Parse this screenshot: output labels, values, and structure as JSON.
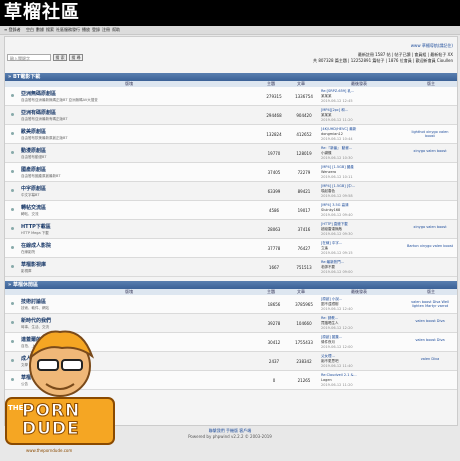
{
  "header": {
    "logo": "草榴社區"
  },
  "topnav": {
    "items": [
      "≡ 登錄者",
      "空白",
      "數據",
      "搜索",
      "社區服務",
      "發行",
      "播放",
      "登錄",
      "注冊",
      "幫助"
    ]
  },
  "userbar": {
    "text": "www 草榴導航(請記住)"
  },
  "stats": {
    "line1": "最新註冊 1587 帖 | 帖子已讀 | 會員組 | 最新帖子 XX",
    "line2": "共 807328 篇主題 | 12252891 篇帖子 | 1876 位會員 | 歡迎新會員 Cioullen"
  },
  "search": {
    "placeholder": "輸入關鍵字",
    "button1": "搜 索",
    "button2": "搜 尋"
  },
  "sections": [
    {
      "title": "» BT電影下載",
      "columns": [
        "版塊",
        "主題",
        "文章",
        "最後發表",
        "版主"
      ],
      "rows": [
        {
          "name": "亞洲無碼原創區",
          "desc": "自由發布亞洲最新無碼正版BT 亞洲無碼AV大搜查",
          "topics": "279315",
          "posts": "1336754",
          "last_title": "Re:[SRPZ-659] 乳...",
          "last_user": "某某某",
          "last_time": "2019-06-12 12:45",
          "mod": ""
        },
        {
          "name": "亞洲有碼原創區",
          "desc": "自由發布亞洲最新有碼正版BT",
          "topics": "294468",
          "posts": "904420",
          "last_title": "[MP4][2pc] 和...",
          "last_user": "某某某",
          "last_time": "2019-06-12 11:20",
          "mod": ""
        },
        {
          "name": "歐美原創區",
          "desc": "自由發布歐美最新原創正版BT",
          "topics": "132824",
          "posts": "412652",
          "last_title": "[4K/UHD/HEVC] 最新",
          "last_user": "dongmian12",
          "last_time": "2019-06-12 10:44",
          "mod": "lighthot xinygo valen boost"
        },
        {
          "name": "動漫原創區",
          "desc": "自由發布動漫BT",
          "topics": "19770",
          "posts": "128019",
          "last_title": "Re:『新番』 動畫...",
          "last_user": "小蝴蝶",
          "last_time": "2019-06-12 10:30",
          "mod": "xinygo valen boost"
        },
        {
          "name": "國產原創區",
          "desc": "自由發布國產原創最新BT",
          "topics": "37405",
          "posts": "72279",
          "last_title": "[MP4] [1.5GB] 國產",
          "last_user": "Wenzero",
          "last_time": "2019-06-12 10:11",
          "mod": ""
        },
        {
          "name": "中字原創區",
          "desc": "中文字幕BT",
          "topics": "63399",
          "posts": "89421",
          "last_title": "[MP4] [1.5GB] [中...",
          "last_user": "喚起春色",
          "last_time": "2019-06-12 09:58",
          "mod": ""
        },
        {
          "name": "轉帖交流區",
          "desc": "轉帖、交流",
          "topics": "4586",
          "posts": "19017",
          "last_title": "[MP4] 3.5G 高清",
          "last_user": "Sluinky168",
          "last_time": "2019-06-12 09:40",
          "mod": ""
        },
        {
          "name": "HTTP下載區",
          "desc": "HTTP Mega 下載",
          "topics": "28063",
          "posts": "37416",
          "last_title": "[HTTP] 直鏈下載",
          "last_user": "超級雷達無敵",
          "last_time": "2019-06-12 09:30",
          "mod": "xinygo valen boost"
        },
        {
          "name": "在線成人影院",
          "desc": "在線影院",
          "topics": "37778",
          "posts": "76427",
          "last_title": "[在線] 中字...",
          "last_user": "立遙",
          "last_time": "2019-06-12 09:15",
          "mod": "Barton xinygo valen boost"
        },
        {
          "name": "草榴影視庫",
          "desc": "影視庫",
          "topics": "1667",
          "posts": "751513",
          "last_title": "Re:最新熱門...",
          "last_user": "老師不要",
          "last_time": "2019-06-12 09:00",
          "mod": ""
        }
      ]
    },
    {
      "title": "» 草榴休閒區",
      "columns": [
        "版塊",
        "主題",
        "文章",
        "最後發表",
        "版主"
      ],
      "rows": [
        {
          "name": "技術討論區",
          "desc": "技術、軟件、網站",
          "topics": "18656",
          "posts": "3785965",
          "last_title": "[原創] 小說...",
          "last_user": "圍不遠鐵樹",
          "last_time": "2019-06-12 12:40",
          "mod": "valen boost Diva Well lighten Martyr varrot"
        },
        {
          "name": "新時代的我們",
          "desc": "時事、生活、交流",
          "topics": "39278",
          "posts": "104660",
          "last_title": "Re: 請教...",
          "last_user": "買腦喝生人",
          "last_time": "2019-06-12 12:20",
          "mod": "valen boost Diva"
        },
        {
          "name": "達蓋爾的旗幟",
          "desc": "自拍、上傳",
          "topics": "30412",
          "posts": "1755433",
          "last_title": "[原創] 圖集...",
          "last_user": "條件夜月",
          "last_time": "2019-06-12 12:00",
          "mod": "valen boost Diva"
        },
        {
          "name": "成人文學交流區",
          "desc": "文學",
          "topics": "2437",
          "posts": "238342",
          "last_title": "父女理...",
          "last_user": "痴不更思吧",
          "last_time": "2019-06-12 11:40",
          "mod": "valen Diva"
        },
        {
          "name": "草榴公告",
          "desc": "公告",
          "topics": "0",
          "posts": "21265",
          "last_title": "Re:Cloudveil 2.1 &...",
          "last_user": "Lagen",
          "last_time": "2019-06-12 11:20",
          "mod": ""
        }
      ]
    }
  ],
  "footer": {
    "links": "聯繫我們 手機版 客戶端",
    "copy": "Powered by phpwind v2.2.2 © 2003-2019"
  },
  "badge": {
    "line1": "THE",
    "line2": "PORN",
    "line3": "DUDE",
    "line4": "www.theporndude.com"
  },
  "colors": {
    "header": "#000000",
    "section": "#3b6196",
    "accent": "#1a3a6a"
  }
}
